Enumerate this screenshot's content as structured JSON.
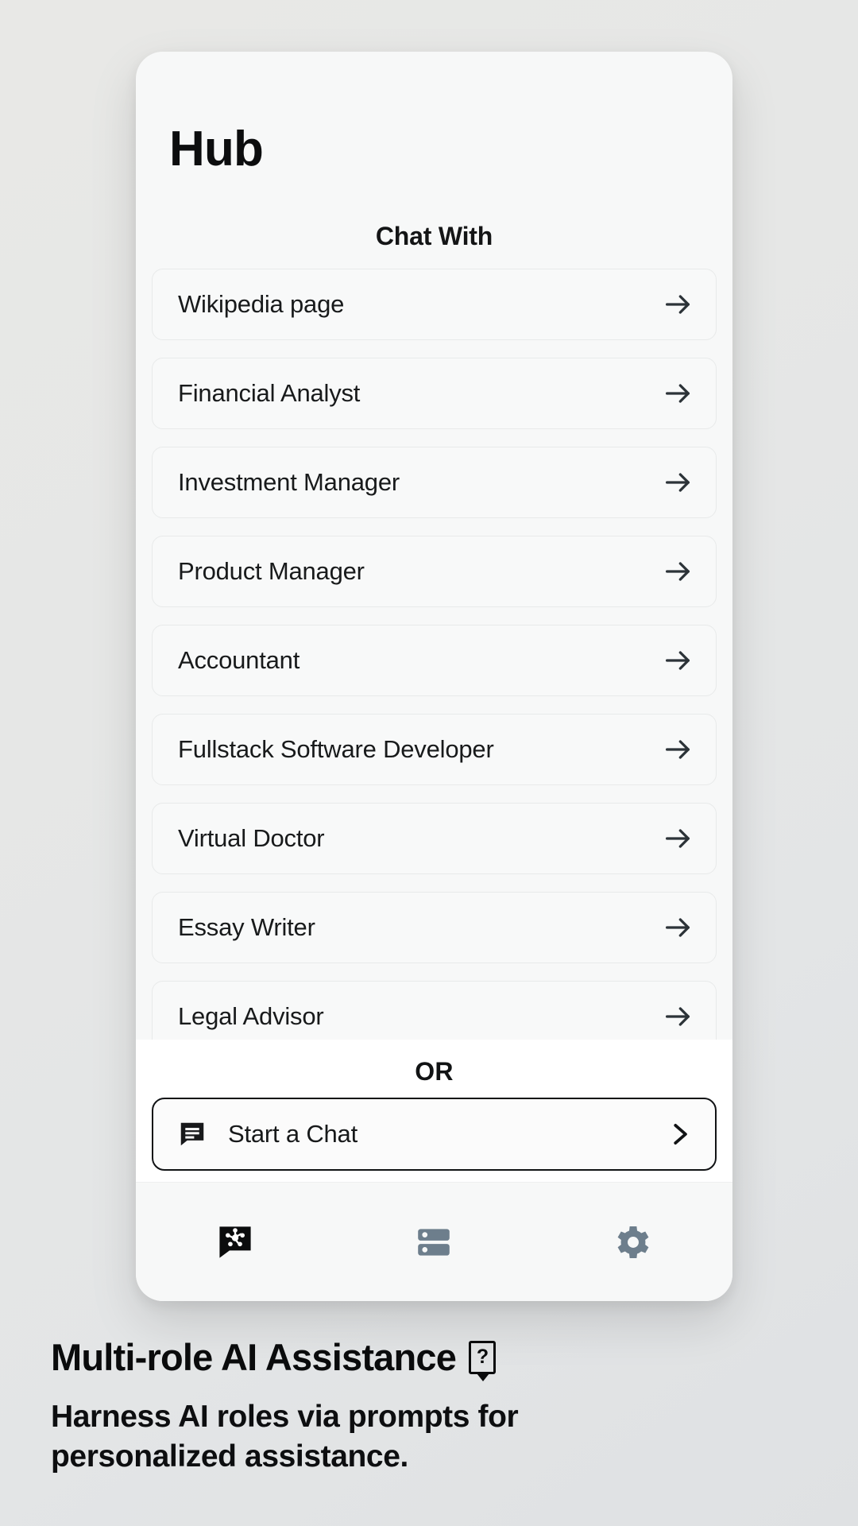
{
  "app": {
    "title": "Hub"
  },
  "section": {
    "header": "Chat With"
  },
  "roles": [
    {
      "label": "Wikipedia page",
      "icon": "arrow-right-icon"
    },
    {
      "label": "Financial Analyst",
      "icon": "arrow-right-icon"
    },
    {
      "label": "Investment Manager",
      "icon": "arrow-right-icon"
    },
    {
      "label": "Product Manager",
      "icon": "arrow-right-icon"
    },
    {
      "label": "Accountant",
      "icon": "arrow-right-icon"
    },
    {
      "label": "Fullstack Software Developer",
      "icon": "arrow-right-icon"
    },
    {
      "label": "Virtual Doctor",
      "icon": "arrow-right-icon"
    },
    {
      "label": "Essay Writer",
      "icon": "arrow-right-icon"
    },
    {
      "label": "Legal Advisor",
      "icon": "arrow-right-icon"
    }
  ],
  "cta": {
    "divider_label": "OR",
    "start_chat_label": "Start a Chat",
    "start_chat_icon": "chat-message-icon",
    "chevron_icon": "chevron-right-icon"
  },
  "bottom_nav": [
    {
      "name": "hub",
      "icon": "chat-hub-icon",
      "active": true
    },
    {
      "name": "library",
      "icon": "server-stack-icon",
      "active": false
    },
    {
      "name": "settings",
      "icon": "gear-icon",
      "active": false
    }
  ],
  "caption": {
    "title": "Multi-role AI Assistance",
    "title_glyph": "?",
    "body": "Harness AI roles via prompts for personalized assistance."
  },
  "colors": {
    "page_background": "#e7e8e7",
    "card_background": "#f7f8f8",
    "text_primary": "#0c0d0e",
    "border": "#e8eaea",
    "nav_active": "#0b0c0d",
    "nav_inactive": "#6d7e8c",
    "cta_border": "#111315"
  }
}
